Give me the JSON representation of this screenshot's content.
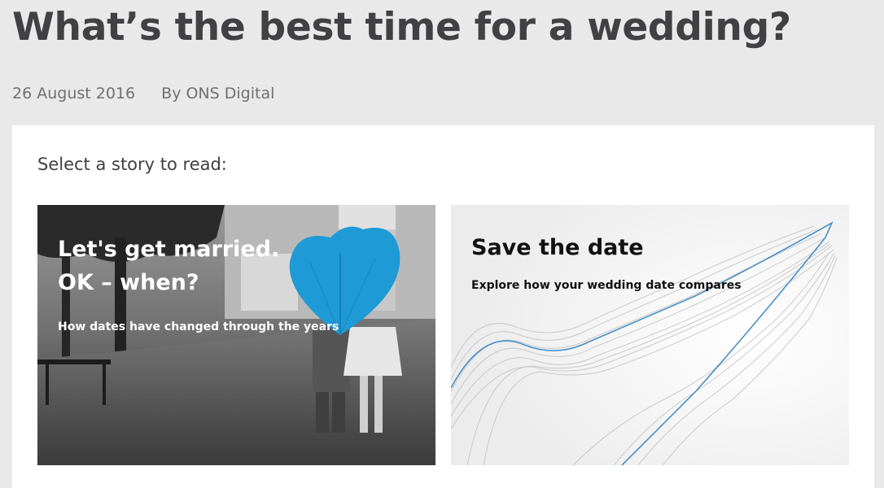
{
  "article": {
    "title": "What’s the best time for a wedding?",
    "date": "26 August 2016",
    "author": "By ONS Digital"
  },
  "selector": {
    "prompt": "Select a story to read:"
  },
  "stories": [
    {
      "title": "Let's get married. OK – when?",
      "subtitle": "How dates have changed through the years"
    },
    {
      "title": "Save the date",
      "subtitle": "Explore how your wedding date compares"
    }
  ],
  "colors": {
    "page_bg": "#e9e9e9",
    "panel_bg": "#ffffff",
    "accent_blue": "#1e9ad6",
    "title_text": "#414042"
  }
}
